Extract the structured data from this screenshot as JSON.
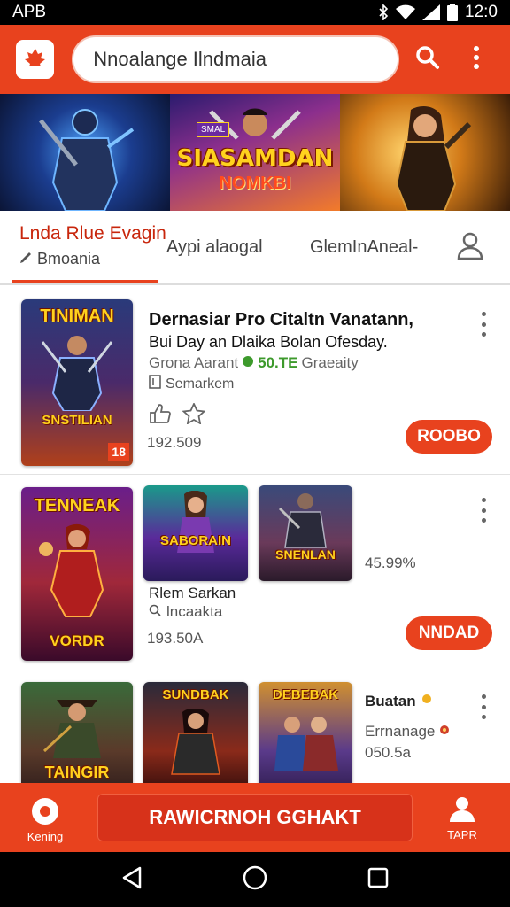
{
  "status_bar": {
    "carrier": "APB",
    "time": "12:0"
  },
  "search": {
    "value": "Nnoalange Ilndmaia"
  },
  "banner": {
    "title": "SIASAMDAN",
    "subtitle": "NOMKBI",
    "tag": "SMAL"
  },
  "tabs": {
    "active_title": "Lnda Rlue Evagin",
    "active_sub": "Bmoania",
    "tab2": "Aypi alaogal",
    "tab3": "GlemInAneal-"
  },
  "card1": {
    "cover_title": "TINIMAN",
    "cover_sub": "SNSTILIAN",
    "cover_badge": "18",
    "title": "Dernasiar Pro Citaltn Vanatann,",
    "subtitle": "Bui Day an Dlaika Bolan Ofesday.",
    "meta_left": "Grona Aarant",
    "meta_rating": "50.TE",
    "meta_right": "Graeaity",
    "developer": "Semarkem",
    "price": "192.509",
    "button": "ROOBO"
  },
  "card2": {
    "cover1_title": "TENNEAK",
    "cover1_sub": "VORDR",
    "cover2_title": "SABORAIN",
    "cover3_title": "SNENLAN",
    "percent": "45.99%",
    "name": "Rlem Sarkan",
    "developer": "lncaakta",
    "price": "193.50A",
    "button": "NNDAD"
  },
  "card3": {
    "cover1_title": "TAINGIR",
    "cover2_title": "SUNDBAK",
    "cover3_title": "DEBEBAK",
    "name": "Buatan",
    "sub": "Errnanage",
    "price": "050.5a"
  },
  "bottom_bar": {
    "left_label": "Kening",
    "cta": "RAWICRNOH GGHAKT",
    "right_label": "TAPR"
  },
  "colors": {
    "accent": "#e8421e",
    "accent_dark": "#d7321a",
    "rating_green": "#3d9a2c"
  }
}
